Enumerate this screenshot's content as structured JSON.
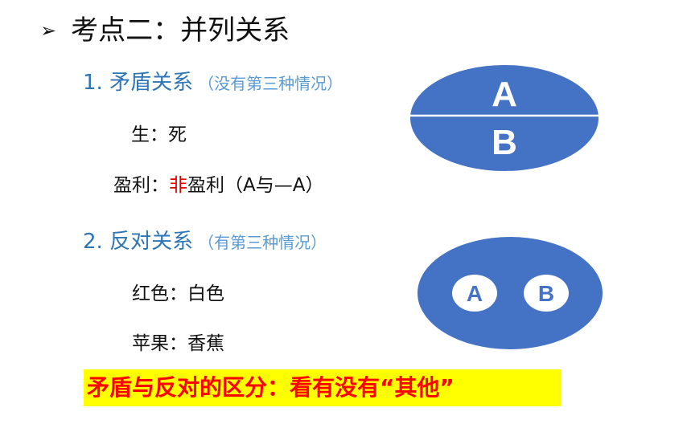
{
  "title": {
    "bullet": "➢",
    "text": "考点二：并列关系"
  },
  "section1": {
    "heading": "1.  矛盾关系",
    "note": "（没有第三种情况）",
    "example1": "生：死",
    "example2": {
      "prefix": "盈利：",
      "highlight": "非",
      "suffix": "盈利（A与—A）"
    }
  },
  "section2": {
    "heading": "2.  反对关系",
    "note": "（有第三种情况）",
    "example1": "红色：白色",
    "example2": "苹果：香蕉"
  },
  "diagram1": {
    "label_a": "A",
    "label_b": "B"
  },
  "diagram2": {
    "label_a": "A",
    "label_b": "B"
  },
  "conclusion": "矛盾与反对的区分：看有没有“其他”",
  "colors": {
    "ellipse": "#4472c4",
    "heading": "#2e75b6",
    "note": "#5b9bd5",
    "emphasis": "#ff0000",
    "highlight_bg": "#ffff00"
  }
}
